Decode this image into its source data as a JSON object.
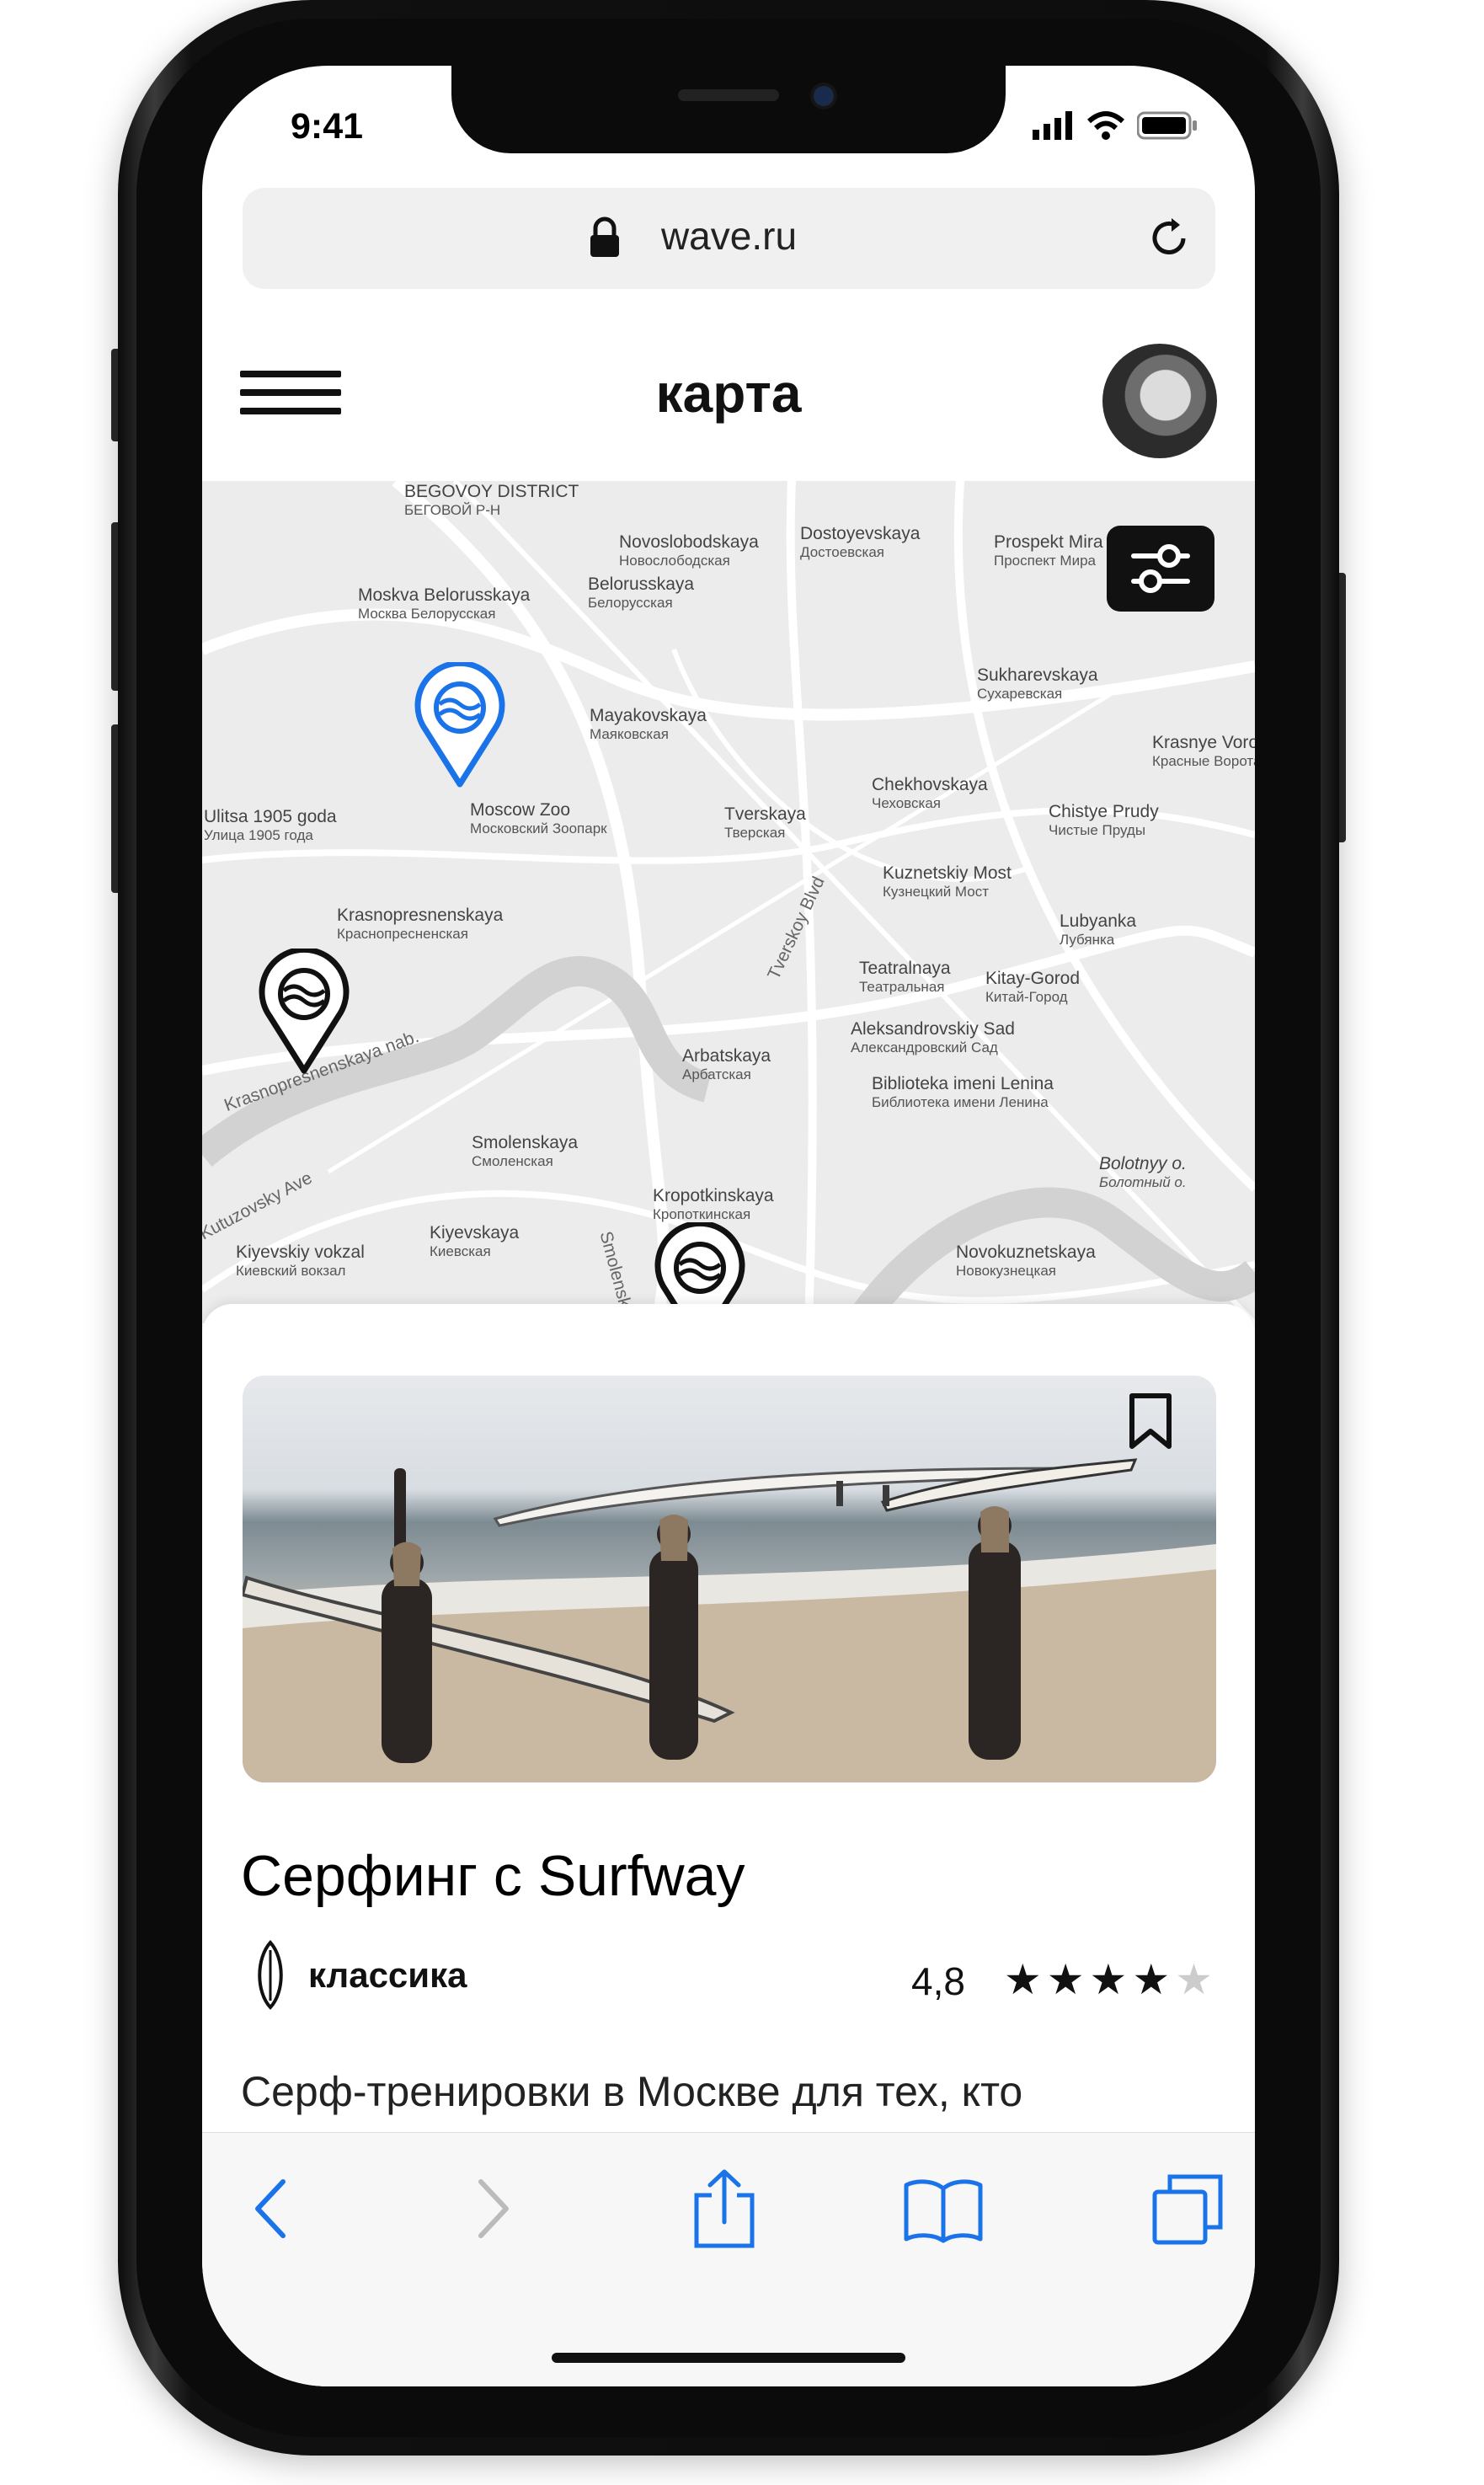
{
  "status_bar": {
    "time": "9:41"
  },
  "browser": {
    "url": "wave.ru"
  },
  "app_header": {
    "title": "карта"
  },
  "map": {
    "labels": [
      {
        "en": "BEGOVOY DISTRICT",
        "ru": "БЕГОВОЙ Р-Н"
      },
      {
        "en": "Novoslobodskaya",
        "ru": "Новослободская"
      },
      {
        "en": "Dostoyevskaya",
        "ru": "Достоевская"
      },
      {
        "en": "Prospekt Mira",
        "ru": "Проспект Мира"
      },
      {
        "en": "Moskva Belorusskaya",
        "ru": "Москва Белорусская"
      },
      {
        "en": "Belorusskaya",
        "ru": "Белорусская"
      },
      {
        "en": "Sukharevskaya",
        "ru": "Сухаревская"
      },
      {
        "en": "Mayakovskaya",
        "ru": "Маяковская"
      },
      {
        "en": "Krasnye Vorota",
        "ru": "Красные Ворота"
      },
      {
        "en": "Moscow Zoo",
        "ru": "Московский Зоопарк"
      },
      {
        "en": "Tverskaya",
        "ru": "Тверская"
      },
      {
        "en": "Chekhovskaya",
        "ru": "Чеховская"
      },
      {
        "en": "Chistye Prudy",
        "ru": "Чистые Пруды"
      },
      {
        "en": "Ulitsa 1905 goda",
        "ru": "Улица 1905 года"
      },
      {
        "en": "Kuznetskiy Most",
        "ru": "Кузнецкий Мост"
      },
      {
        "en": "Krasnopresnenskaya",
        "ru": "Краснопресненская"
      },
      {
        "en": "Lubyanka",
        "ru": "Лубянка"
      },
      {
        "en": "Teatralnaya",
        "ru": "Театральная"
      },
      {
        "en": "Kitay-Gorod",
        "ru": "Китай-Город"
      },
      {
        "en": "Aleksandrovskiy Sad",
        "ru": "Александровский Сад"
      },
      {
        "en": "Arbatskaya",
        "ru": "Арбатская"
      },
      {
        "en": "Biblioteka imeni Lenina",
        "ru": "Библиотека имени Ленина"
      },
      {
        "en": "Smolenskaya",
        "ru": "Смоленская"
      },
      {
        "en": "Bolotnyy o.",
        "ru": "Болотный о."
      },
      {
        "en": "Kropotkinskaya",
        "ru": "Кропоткинская"
      },
      {
        "en": "Kiyevskaya",
        "ru": "Киевская"
      },
      {
        "en": "Kiyevskiy vokzal",
        "ru": "Киевский вокзал"
      },
      {
        "en": "Novokuznetskaya",
        "ru": "Новокузнецкая"
      }
    ],
    "street_labels": [
      "Krasnopresnenskaya nab.",
      "Tverskoy Blvd",
      "Smolensky",
      "Kutuzovsky Ave"
    ],
    "colors": {
      "active_pin": "#1a73e8",
      "pin": "#111111"
    }
  },
  "card": {
    "title": "Серфинг с Surfway",
    "category": "классика",
    "category_icon": "surfboard-icon",
    "rating": "4,8",
    "stars_filled": "★★★★",
    "stars_empty": "★",
    "stars_value": 4,
    "description": "Серф-тренировки в Москве для тех, кто увлекается катанием на волнах, или тех"
  },
  "toolbar": {
    "icons": [
      "back-icon",
      "forward-icon",
      "share-icon",
      "bookmarks-icon",
      "tabs-icon"
    ],
    "accent": "#1a73e8"
  }
}
